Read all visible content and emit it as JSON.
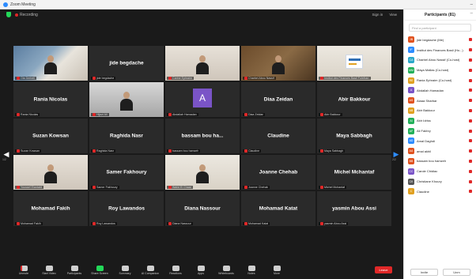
{
  "window": {
    "title": "Zoom Meeting"
  },
  "topbar": {
    "security_label": "Recording",
    "view_label": "View",
    "gallery_label": "Sign in"
  },
  "pages": {
    "left": "1/2",
    "right": "2/2"
  },
  "tiles": [
    {
      "name": "",
      "label": "Ola Derbeli",
      "type": "video",
      "bg": "a",
      "person": true
    },
    {
      "name": "jide begdache",
      "label": "jide begdache",
      "type": "name"
    },
    {
      "name": "",
      "label": "Carine Ephraim",
      "type": "video",
      "bg": "b",
      "person": true
    },
    {
      "name": "",
      "label": "Charbel Abou Nassif",
      "type": "video",
      "bg": "c",
      "person": true
    },
    {
      "name": "",
      "label": "Institut des Finances Basil Fuleihan",
      "type": "logo",
      "bg": "d"
    },
    {
      "name": "Rania Nicolas",
      "label": "Rania Nicolas",
      "type": "name"
    },
    {
      "name": "",
      "label": "Hijazi Ali",
      "type": "video",
      "bg": "f",
      "person": true
    },
    {
      "name": "",
      "label": "Abdallah Hamadan",
      "type": "avatar",
      "initial": "A"
    },
    {
      "name": "Diaa Zeidan",
      "label": "Diaa Zeidan",
      "type": "name"
    },
    {
      "name": "Abir Bakkour",
      "label": "Abir Bakkour",
      "type": "name"
    },
    {
      "name": "Suzan Kowsan",
      "label": "Suzan Kowsan",
      "type": "name"
    },
    {
      "name": "Raghida Nasr",
      "label": "Raghida Nasr",
      "type": "name"
    },
    {
      "name": "bassam bou ha...",
      "label": "bassam bou hamzeh",
      "type": "name"
    },
    {
      "name": "Claudine",
      "label": "Claudine",
      "type": "name"
    },
    {
      "name": "Maya Sabbagh",
      "label": "Maya Sabbagh",
      "type": "name"
    },
    {
      "name": "",
      "label": "Youssef Elantabli",
      "type": "video",
      "bg": "b",
      "person": true
    },
    {
      "name": "Samer Fakhoury",
      "label": "Samer Fakhoury",
      "type": "name"
    },
    {
      "name": "",
      "label": "Walid El Chaar",
      "type": "video",
      "bg": "d",
      "person": true
    },
    {
      "name": "Joanne Chehab",
      "label": "Joanne Chehab",
      "type": "name"
    },
    {
      "name": "Michel Mchantaf",
      "label": "Michel Mchantaf",
      "type": "name"
    },
    {
      "name": "Mohamad Fakih",
      "label": "Mohamad Fakih",
      "type": "name"
    },
    {
      "name": "Roy Lawandos",
      "label": "Roy Lawandos",
      "type": "name"
    },
    {
      "name": "Diana Nassour",
      "label": "Diana Nassour",
      "type": "name"
    },
    {
      "name": "Mohamad Katat",
      "label": "Mohamad Katat",
      "type": "name"
    },
    {
      "name": "yasmin Abou Assi",
      "label": "yasmin Abou Assi",
      "type": "name"
    }
  ],
  "toolbar": [
    {
      "label": "Unmute",
      "icon": "mic-icon"
    },
    {
      "label": "Start Video",
      "icon": "camera-icon"
    },
    {
      "label": "Participants",
      "icon": "people-icon"
    },
    {
      "label": "Share Screen",
      "icon": "share-screen-icon",
      "green": true
    },
    {
      "label": "Summary",
      "icon": "summary-icon"
    },
    {
      "label": "AI Companion",
      "icon": "ai-icon"
    },
    {
      "label": "Reactions",
      "icon": "reactions-icon"
    },
    {
      "label": "Apps",
      "icon": "apps-icon"
    },
    {
      "label": "Whiteboards",
      "icon": "whiteboard-icon"
    },
    {
      "label": "Notes",
      "icon": "notes-icon"
    },
    {
      "label": "More",
      "icon": "more-icon"
    }
  ],
  "end_label": "Leave",
  "panel": {
    "title": "Participants (81)",
    "search_placeholder": "Find a participant",
    "invite_label": "Invite",
    "mute_label": "Unm",
    "participants": [
      {
        "name": "jide begdache (Me)",
        "initials": "JB",
        "color": "#e0521f"
      },
      {
        "name": "Institut des Finances Basil (Ho...)",
        "initials": "IF",
        "color": "#2d8cff"
      },
      {
        "name": "Charbel Abou Nassif (Co-host)",
        "initials": "CA",
        "color": "#2aa7c9"
      },
      {
        "name": "Maya Mallas (Co-host)",
        "initials": "MM",
        "color": "#23b05a"
      },
      {
        "name": "Rania Ephraim (Co-host)",
        "initials": "RE",
        "color": "#e0a020"
      },
      {
        "name": "Abdallah Hamadan",
        "initials": "A",
        "color": "#7a54c7"
      },
      {
        "name": "Alaaa Sharbar",
        "initials": "AS",
        "color": "#e0521f"
      },
      {
        "name": "Abir Bakkour",
        "initials": "AB",
        "color": "#e0a020"
      },
      {
        "name": "Abir Idriss",
        "initials": "AI",
        "color": "#23b05a"
      },
      {
        "name": "Ali Fakhry",
        "initials": "AF",
        "color": "#23b05a"
      },
      {
        "name": "Amal Daghdi",
        "initials": "AD",
        "color": "#2d8cff"
      },
      {
        "name": "amal akhil",
        "initials": "AA",
        "color": "#e0521f"
      },
      {
        "name": "bassam bou hamzeh",
        "initials": "BB",
        "color": "#e0521f"
      },
      {
        "name": "Carole Chidiac",
        "initials": "CC",
        "color": "#7a54c7"
      },
      {
        "name": "Christiane Khoury",
        "initials": "CK",
        "color": "#555555"
      },
      {
        "name": "Claudine",
        "initials": "C",
        "color": "#e0a020"
      }
    ]
  }
}
